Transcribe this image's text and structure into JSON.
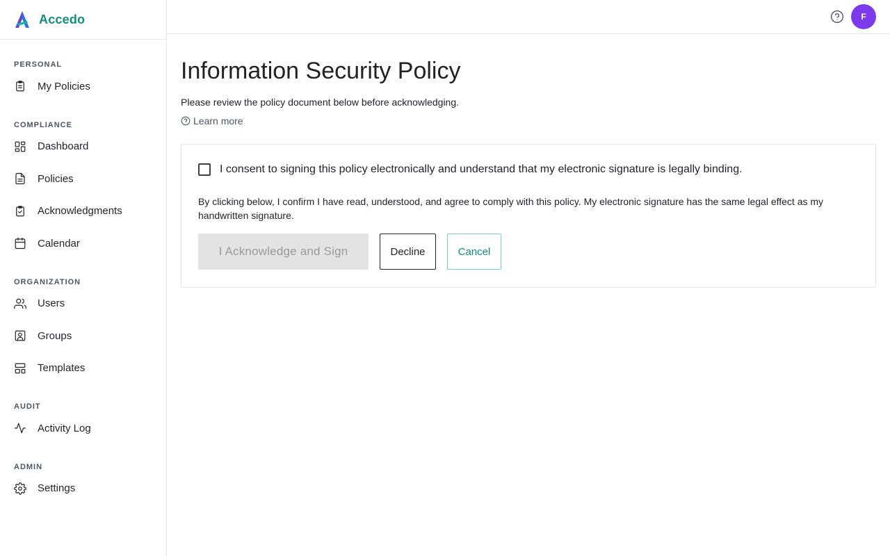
{
  "brand": {
    "name": "Accedo",
    "accent_color": "#0f8f7e",
    "logo_icon": "accedo-logo-icon"
  },
  "sidebar": {
    "sections": [
      {
        "label": "PERSONAL",
        "items": [
          {
            "label": "My Policies",
            "icon": "clipboard-list-icon"
          }
        ]
      },
      {
        "label": "COMPLIANCE",
        "items": [
          {
            "label": "Dashboard",
            "icon": "dashboard-grid-icon"
          },
          {
            "label": "Policies",
            "icon": "document-icon"
          },
          {
            "label": "Acknowledgments",
            "icon": "clipboard-check-icon"
          },
          {
            "label": "Calendar",
            "icon": "calendar-icon"
          }
        ]
      },
      {
        "label": "ORGANIZATION",
        "items": [
          {
            "label": "Users",
            "icon": "users-icon"
          },
          {
            "label": "Groups",
            "icon": "user-square-icon"
          },
          {
            "label": "Templates",
            "icon": "template-layout-icon"
          }
        ]
      },
      {
        "label": "AUDIT",
        "items": [
          {
            "label": "Activity Log",
            "icon": "activity-pulse-icon"
          }
        ]
      },
      {
        "label": "ADMIN",
        "items": [
          {
            "label": "Settings",
            "icon": "gear-icon"
          }
        ]
      }
    ]
  },
  "topbar": {
    "help_icon": "help-circle-icon",
    "avatar_initial": "F",
    "avatar_color": "#7c3aed"
  },
  "main": {
    "title": "Information Security Policy",
    "subtitle": "Please review the policy document below before acknowledging.",
    "learn_more": "Learn more",
    "consent_label": "I consent to signing this policy electronically and understand that my electronic signature is legally binding.",
    "consent_checked": false,
    "confirm_text": "By clicking below, I confirm I have read, understood, and agree to comply with this policy. My electronic signature has the same legal effect as my handwritten signature.",
    "buttons": {
      "acknowledge": "I Acknowledge and Sign",
      "decline": "Decline",
      "cancel": "Cancel"
    }
  }
}
